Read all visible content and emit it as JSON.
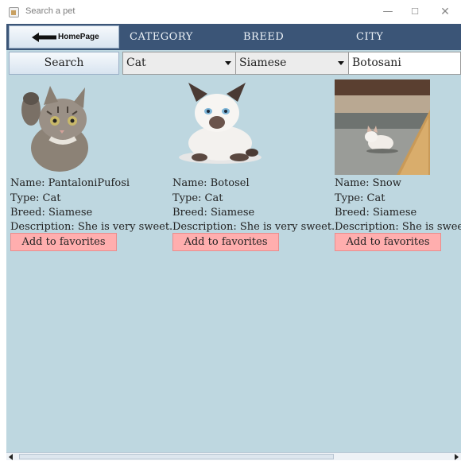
{
  "window": {
    "title": "Search a pet",
    "minimize_glyph": "—",
    "maximize_glyph": "☐",
    "close_glyph": "✕"
  },
  "header": {
    "home_button_label": "HomePage",
    "columns": [
      "CATEGORY",
      "BREED",
      "CITY"
    ]
  },
  "filters": {
    "search_label": "Search",
    "category_value": "Cat",
    "breed_value": "Siamese",
    "city_value": "Botosani"
  },
  "pets": [
    {
      "name_line": "Name: PantaloniPufosi",
      "type_line": "Type: Cat",
      "breed_line": "Breed: Siamese",
      "description_line": "Description: She is very sweet.",
      "favorite_label": "Add to favorites"
    },
    {
      "name_line": "Name: Botosel",
      "type_line": "Type: Cat",
      "breed_line": "Breed: Siamese",
      "description_line": "Description: She is very sweet.",
      "favorite_label": "Add to favorites"
    },
    {
      "name_line": "Name: Snow",
      "type_line": "Type: Cat",
      "breed_line": "Breed: Siamese",
      "description_line": "Description: She is swee",
      "favorite_label": "Add to favorites"
    }
  ],
  "colors": {
    "header_bg": "#3b5577",
    "panel_bg": "#bed7e0",
    "favorite_bg": "#ffaeae"
  },
  "icons": [
    "app-icon",
    "back-arrow-icon",
    "dropdown-arrow-icon",
    "scroll-left-icon",
    "scroll-right-icon"
  ]
}
